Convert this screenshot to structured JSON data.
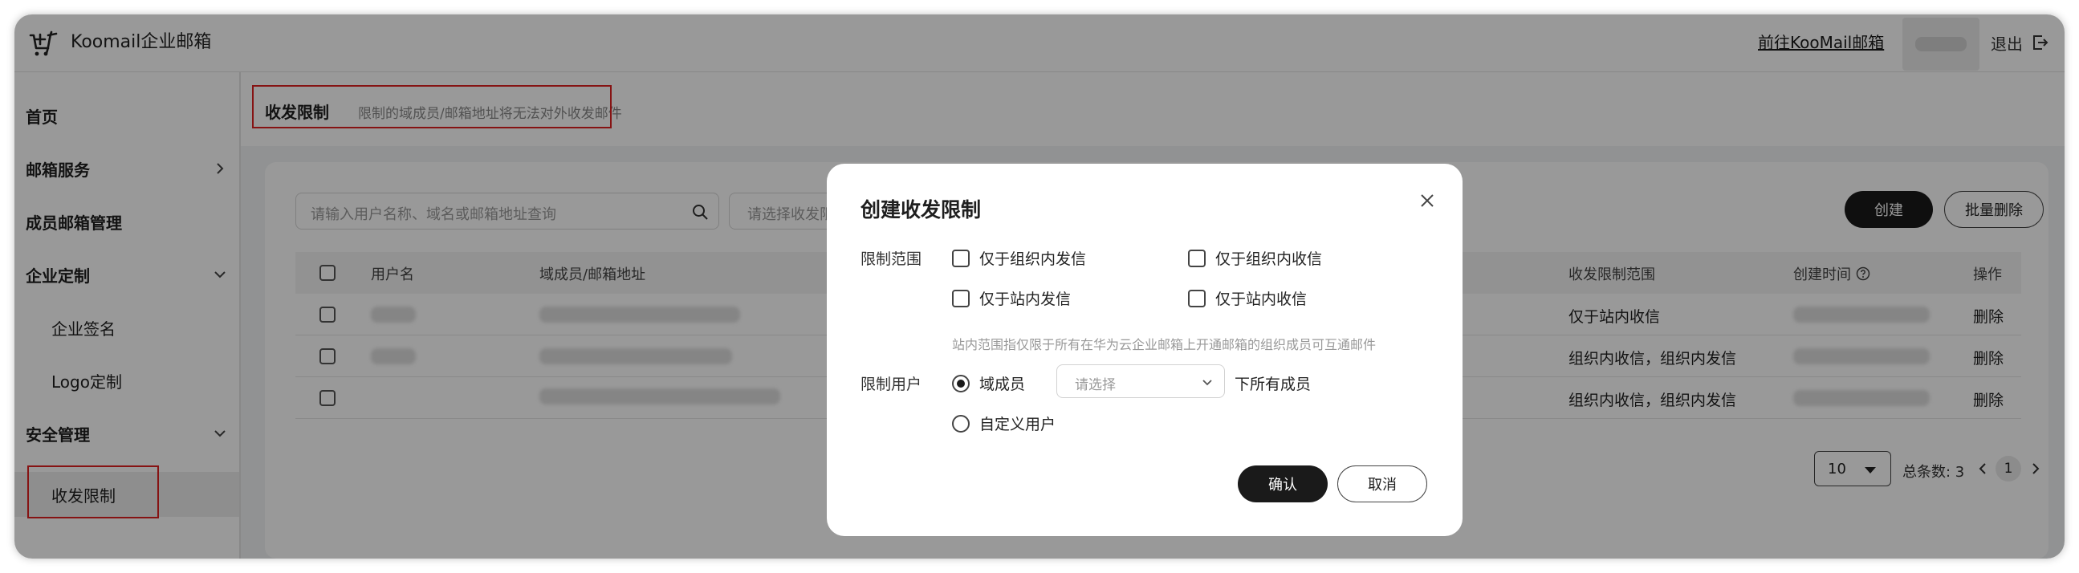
{
  "app": {
    "title": "Koomail企业邮箱",
    "goto_link": "前往KooMail邮箱",
    "logout": "退出"
  },
  "sidebar": {
    "items": [
      {
        "label": "首页"
      },
      {
        "label": "邮箱服务"
      },
      {
        "label": "成员邮箱管理"
      },
      {
        "label": "企业定制"
      },
      {
        "label": "企业签名"
      },
      {
        "label": "Logo定制"
      },
      {
        "label": "安全管理"
      },
      {
        "label": "收发限制"
      }
    ]
  },
  "page": {
    "title": "收发限制",
    "description": "限制的域成员/邮箱地址将无法对外收发邮件"
  },
  "toolbar": {
    "search_placeholder": "请输入用户名称、域名或邮箱地址查询",
    "filter_placeholder": "请选择收发限",
    "create": "创建",
    "batch_delete": "批量删除"
  },
  "table": {
    "headers": {
      "username": "用户名",
      "address": "域成员/邮箱地址",
      "scope": "收发限制范围",
      "created": "创建时间",
      "action": "操作"
    },
    "rows": [
      {
        "scope": "仅于站内收信",
        "action": "删除"
      },
      {
        "scope": "组织内收信，组织内发信",
        "action": "删除"
      },
      {
        "scope": "组织内收信，组织内发信",
        "action": "删除"
      }
    ]
  },
  "pager": {
    "page_size": "10",
    "total_label": "总条数: 3",
    "current_page": "1"
  },
  "modal": {
    "title": "创建收发限制",
    "scope_label": "限制范围",
    "options": {
      "send_org": "仅于组织内发信",
      "recv_org": "仅于组织内收信",
      "send_site": "仅于站内发信",
      "recv_site": "仅于站内收信"
    },
    "hint": "站内范围指仅限于所有在华为云企业邮箱上开通邮箱的组织成员可互通邮件",
    "user_label": "限制用户",
    "radio_domain": "域成员",
    "select_placeholder": "请选择",
    "suffix": "下所有成员",
    "radio_custom": "自定义用户",
    "confirm": "确认",
    "cancel": "取消"
  },
  "colors": {
    "highlight_red": "#e02020",
    "primary_dark": "#1a1a1a"
  }
}
